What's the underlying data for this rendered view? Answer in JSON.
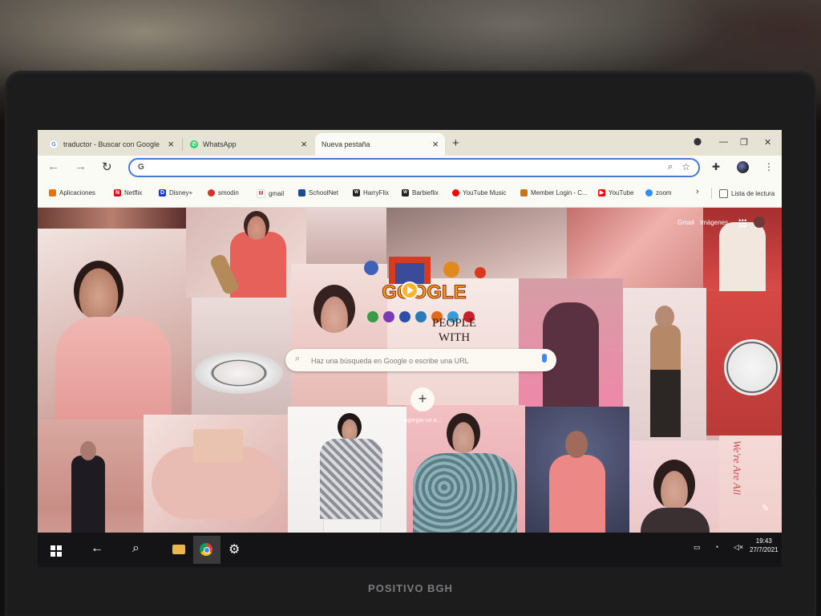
{
  "browser": {
    "tabs": [
      {
        "title": "traductor - Buscar con Google",
        "icon": "google-icon"
      },
      {
        "title": "WhatsApp",
        "icon": "whatsapp-icon"
      },
      {
        "title": "Nueva pestaña",
        "icon": "none",
        "active": true
      }
    ],
    "new_tab_symbol": "+",
    "window_controls": {
      "minimize": "—",
      "restore": "❐",
      "close": "✕"
    },
    "omnibox": {
      "value": ""
    }
  },
  "bookmarks": [
    {
      "label": "Aplicaciones",
      "icon": "apps-grid-icon",
      "color": "#e8710a"
    },
    {
      "label": "Netflix",
      "icon": "netflix-icon",
      "color": "#e50914"
    },
    {
      "label": "Disney+",
      "icon": "disney-icon",
      "color": "#113ccf"
    },
    {
      "label": "smodin",
      "icon": "smodin-icon",
      "color": "#d93025"
    },
    {
      "label": "gmail",
      "icon": "gmail-icon",
      "color": "#d93025"
    },
    {
      "label": "SchoolNet",
      "icon": "schoolnet-icon",
      "color": "#1a4b8c"
    },
    {
      "label": "HarryFlix",
      "icon": "wix-icon",
      "color": "#222222"
    },
    {
      "label": "Barbieflix",
      "icon": "wix-icon",
      "color": "#222222"
    },
    {
      "label": "YouTube Music",
      "icon": "youtube-music-icon",
      "color": "#ff0000"
    },
    {
      "label": "Member Login - C...",
      "icon": "member-login-icon",
      "color": "#c8741b"
    },
    {
      "label": "YouTube",
      "icon": "youtube-icon",
      "color": "#ff0000"
    },
    {
      "label": "zoom",
      "icon": "zoom-icon",
      "color": "#2d8cff"
    }
  ],
  "reading_list": "Lista de lectura",
  "ntp": {
    "gmail_link": "Gmail",
    "images_link": "Imágenes",
    "search_placeholder": "Haz una búsqueda en Google o escribe una URL",
    "shortcut_label": "Agregar un a...",
    "doodle_text": "GOOGLE",
    "poster_line1": "PEOPLE",
    "poster_line2": "WITH",
    "side_text": "We're Are All"
  },
  "taskbar": {
    "time": "19:43",
    "date": "27/7/2021"
  },
  "laptop_brand": "POSITIVO BGH",
  "colors": {
    "accent": "#4a79cf",
    "tab_bar": "#e6e2d4",
    "taskbar": "#141416"
  }
}
